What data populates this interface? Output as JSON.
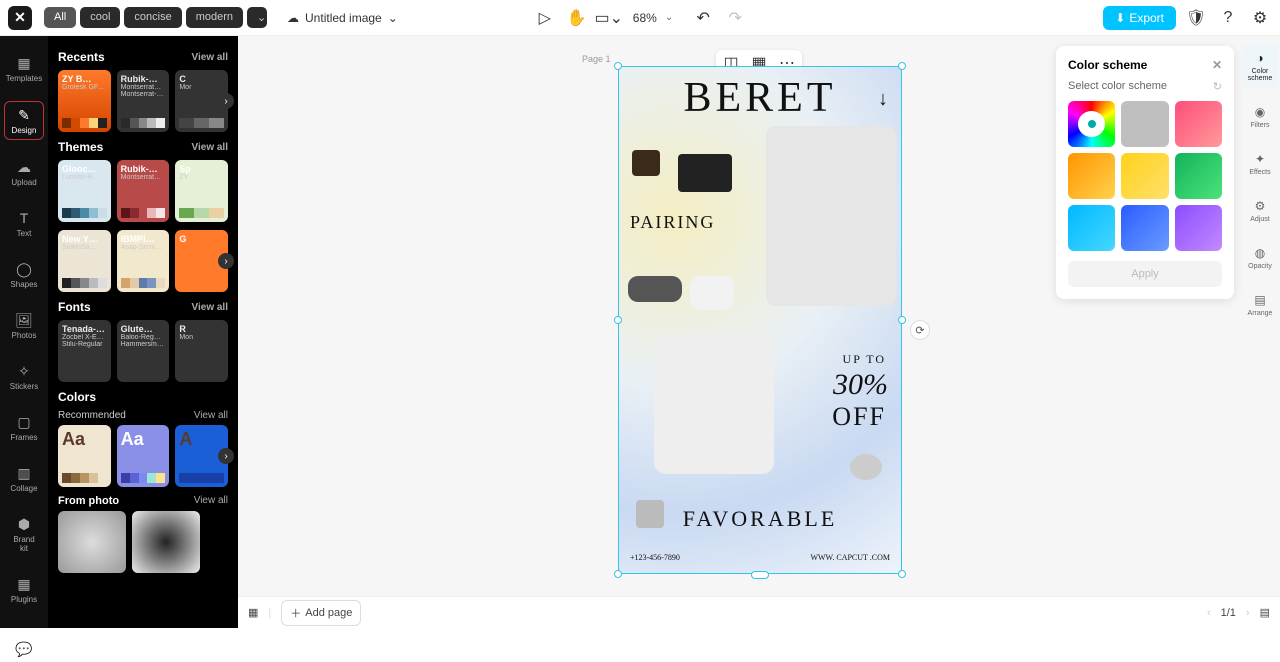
{
  "topbar": {
    "chips": [
      "All",
      "cool",
      "concise",
      "modern"
    ],
    "title": "Untitled image",
    "zoom": "68%",
    "export_label": "Export"
  },
  "leftrail": {
    "items": [
      "Templates",
      "Design",
      "Upload",
      "Text",
      "Shapes",
      "Photos",
      "Stickers",
      "Frames",
      "Collage",
      "Brand\nkit",
      "Plugins"
    ]
  },
  "design_panel": {
    "recents": {
      "title": "Recents",
      "viewall": "View all",
      "cards": [
        {
          "title": "ZY B…",
          "sub": "Grotesk GF-B…",
          "swatches": [
            "#7a2e00",
            "#d34b00",
            "#ff7a2a",
            "#ffd27a",
            "#222"
          ]
        },
        {
          "title": "Rubik-…",
          "sub": "Montserrat…",
          "sub2": "Montserrat-Rg",
          "swatches": [
            "#2a2a2a",
            "#555",
            "#888",
            "#bbb",
            "#eee"
          ]
        },
        {
          "title": "C",
          "sub": "Mor",
          "swatches": [
            "#444",
            "#666",
            "#888"
          ]
        }
      ]
    },
    "themes": {
      "title": "Themes",
      "viewall": "View all",
      "cards": [
        {
          "title": "Glooc…",
          "sub": "Lucette-R…",
          "swatches": [
            "#1b3a4a",
            "#2e5a73",
            "#4d8aa6",
            "#8fbdd1",
            "#ccdde6"
          ],
          "bg": "#d9e7ef"
        },
        {
          "title": "Rubik-…",
          "sub": "Montserrat…",
          "swatches": [
            "#5c1518",
            "#8a2a2e",
            "#b94a4a",
            "#e9b7b7",
            "#f7e6e6"
          ],
          "bg": "#b94a4a"
        },
        {
          "title": "Sp",
          "sub": "ZY",
          "swatches": [
            "#6aa84f",
            "#b6d7a8",
            "#ead1a3"
          ],
          "bg": "#e6f0d7"
        },
        {
          "title": "New Y…",
          "sub": "SinkinSa…",
          "swatches": [
            "#222",
            "#555",
            "#888",
            "#bbb",
            "#ddd"
          ],
          "bg": "#ece4d5"
        },
        {
          "title": "IBMPl…",
          "sub": "Asap-SemiB…",
          "swatches": [
            "#d4a36a",
            "#e2c9a8",
            "#5d7aa8",
            "#7a94c2",
            "#ecd9bd"
          ],
          "bg": "#f2e8cd"
        },
        {
          "title": "G",
          "sub": "",
          "swatches": [
            "#ff7a2a"
          ],
          "bg": "#ff7a2a"
        }
      ]
    },
    "fonts": {
      "title": "Fonts",
      "viewall": "View all",
      "cards": [
        {
          "title": "Tenada-…",
          "sub": "Zocbel X-E…",
          "sub2": "Stilu-Regular"
        },
        {
          "title": "Glute…",
          "sub": "Baloo-Reg…",
          "sub2": "HammersmithOn…"
        },
        {
          "title": "R",
          "sub": "Mon"
        }
      ]
    },
    "colors": {
      "title": "Colors",
      "recommended": "Recommended",
      "viewall": "View all",
      "cards": [
        {
          "title": "Aa",
          "swatches": [
            "#6a4a2a",
            "#8a6a3a",
            "#b89560",
            "#d9c29a",
            "#efe5d0"
          ],
          "bg": "#efe5d0"
        },
        {
          "title": "Aa",
          "swatches": [
            "#3a3fa8",
            "#5c62d6",
            "#7a8aef",
            "#9ee6d6",
            "#ffe38a"
          ],
          "bg": "#8a8fe8"
        },
        {
          "title": "A",
          "swatches": [
            "#1b3fa8"
          ],
          "bg": "#1b5fd6"
        }
      ]
    },
    "from_photo": {
      "title": "From photo",
      "viewall": "View all"
    }
  },
  "page": {
    "label": "Page 1"
  },
  "artboard": {
    "beret": "BERET",
    "pairing": "PAIRING",
    "upto": "UP TO",
    "percent": "30%",
    "off": "OFF",
    "favorable": "FAVORABLE",
    "phone": "+123-456-7890",
    "url": "WWW. CAPCUT .COM"
  },
  "color_scheme_panel": {
    "title": "Color scheme",
    "subtitle": "Select color scheme",
    "swatches": [
      "wheel",
      "#bfbfbf",
      "linear-gradient(135deg,#ff4d7a,#ff9a9a)",
      "linear-gradient(135deg,#ff9500,#ffd24d)",
      "linear-gradient(135deg,#ffd21a,#ffdf6a)",
      "linear-gradient(135deg,#12b35a,#4de27a)",
      "linear-gradient(135deg,#00b8ff,#45d8ff)",
      "linear-gradient(135deg,#2a5cff,#6a9cff)",
      "linear-gradient(135deg,#8a4dff,#c48aff)"
    ],
    "apply": "Apply"
  },
  "rightrail": {
    "items": [
      "Color\nscheme",
      "Filters",
      "Effects",
      "Adjust",
      "Opacity",
      "Arrange"
    ]
  },
  "bottombar": {
    "add_page": "Add page",
    "counter": "1/1"
  }
}
